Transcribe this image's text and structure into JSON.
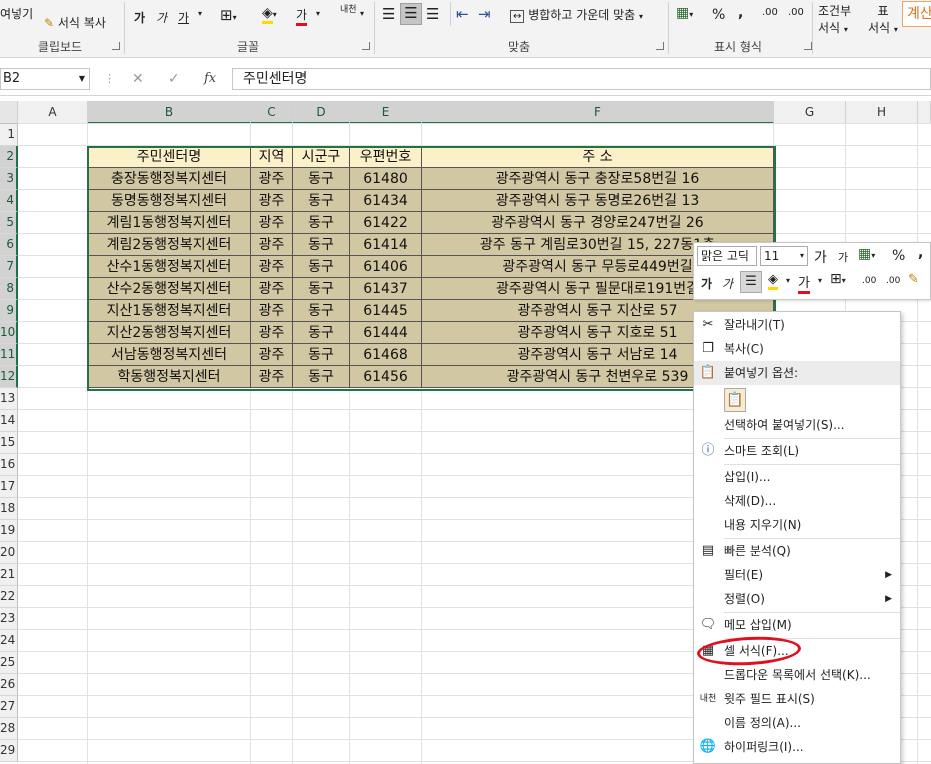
{
  "ribbon": {
    "clipboard": {
      "format_painter": "서식 복사",
      "cut_partial": "여넣기",
      "label": "클립보드"
    },
    "font": {
      "label": "글꼴",
      "bold_a": "가",
      "italic_a": "가",
      "underline_a": "가",
      "font_color": "가",
      "hanja": "내천"
    },
    "align": {
      "merge": "병합하고 가운데 맞춤",
      "label": "맞춤"
    },
    "number": {
      "pct": "%",
      "comma": ",",
      "inc": ".00",
      "label": "표시 형식"
    },
    "styles": {
      "cond1": "조건부",
      "cond2": "서식",
      "table1": "표",
      "table2": "서식",
      "calc": "계산"
    }
  },
  "formula_bar": {
    "name_box": "B2",
    "cancel": "✕",
    "enter": "✓",
    "fx": "fx",
    "content": "주민센터명"
  },
  "columns": [
    "A",
    "B",
    "C",
    "D",
    "E",
    "F",
    "G",
    "H"
  ],
  "rows": [
    "1",
    "2",
    "3",
    "4",
    "5",
    "6",
    "7",
    "8",
    "9",
    "10",
    "11",
    "12",
    "13",
    "14",
    "15",
    "16",
    "17",
    "18",
    "19",
    "20",
    "21",
    "22",
    "23",
    "24",
    "25",
    "26",
    "27",
    "28",
    "29"
  ],
  "table": {
    "headers": [
      "주민센터명",
      "지역",
      "시군구",
      "우편번호",
      "주    소"
    ],
    "rows": [
      [
        "충장동행정복지센터",
        "광주",
        "동구",
        "61480",
        "광주광역시 동구 충장로58번길 16"
      ],
      [
        "동명동행정복지센터",
        "광주",
        "동구",
        "61434",
        "광주광역시 동구 동명로26번길 13"
      ],
      [
        "계림1동행정복지센터",
        "광주",
        "동구",
        "61422",
        "광주광역시 동구 경양로247번길 26"
      ],
      [
        "계림2동행정복지센터",
        "광주",
        "동구",
        "61414",
        "광주 동구 계림로30번길 15, 227동1층"
      ],
      [
        "산수1동행정복지센터",
        "광주",
        "동구",
        "61406",
        "광주광역시 동구 무등로449번길"
      ],
      [
        "산수2동행정복지센터",
        "광주",
        "동구",
        "61437",
        "광주광역시 동구 필문대로191번길"
      ],
      [
        "지산1동행정복지센터",
        "광주",
        "동구",
        "61445",
        "광주광역시 동구 지산로 57"
      ],
      [
        "지산2동행정복지센터",
        "광주",
        "동구",
        "61444",
        "광주광역시 동구 지호로 51"
      ],
      [
        "서남동행정복지센터",
        "광주",
        "동구",
        "61468",
        "광주광역시 동구 서남로 14"
      ],
      [
        "학동행정복지센터",
        "광주",
        "동구",
        "61456",
        "광주광역시 동구 천변우로 539"
      ]
    ]
  },
  "mini_toolbar": {
    "font": "맑은 고딕",
    "size": "11",
    "grow": "가",
    "shrink": "가",
    "pct": "%",
    "comma": ",",
    "bold": "가",
    "italic": "가",
    "font_color": "가",
    "dec_inc": ".00"
  },
  "context_menu": {
    "cut": "잘라내기(T)",
    "copy": "복사(C)",
    "paste_options": "붙여넣기 옵션:",
    "paste_special": "선택하여 붙여넣기(S)...",
    "smart_lookup": "스마트 조회(L)",
    "insert": "삽입(I)...",
    "delete": "삭제(D)...",
    "clear": "내용 지우기(N)",
    "quick_analysis": "빠른 분석(Q)",
    "filter": "필터(E)",
    "sort": "정렬(O)",
    "insert_comment": "메모 삽입(M)",
    "format_cells": "셀 서식(F)...",
    "pick_list": "드롭다운 목록에서 선택(K)...",
    "phonetic": "윗주 필드 표시(S)",
    "define_name": "이름 정의(A)...",
    "hyperlink": "하이퍼링크(I)..."
  },
  "colors": {
    "excel_green": "#217346",
    "header_fill": "#fcf0c8",
    "body_fill": "#d1c7a2",
    "highlight_circle": "#e0101e"
  }
}
